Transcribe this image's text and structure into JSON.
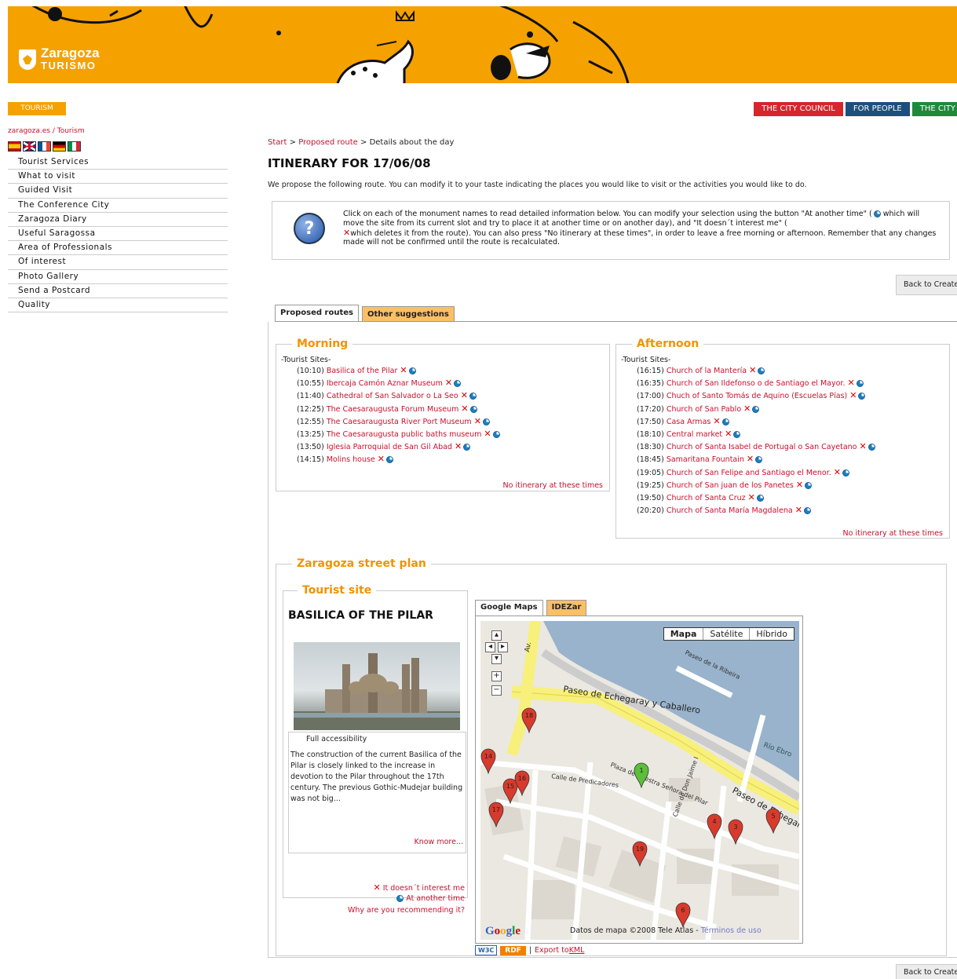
{
  "header": {
    "logo_line1": "Zaragoza",
    "logo_line2": "TURISMO",
    "tourism_tab": "TOURISM",
    "top_tabs": [
      {
        "label": "THE CITY COUNCIL",
        "color": "#d6252d"
      },
      {
        "label": "FOR PEOPLE",
        "color": "#1d4f7c"
      },
      {
        "label": "THE CITY",
        "color": "#1c8a3a"
      }
    ]
  },
  "sidebar": {
    "breadcrumb": "zaragoza.es / Tourism",
    "flags": [
      "spanish-flag-icon",
      "english-flag-icon",
      "french-flag-icon",
      "german-flag-icon",
      "italian-flag-icon"
    ],
    "items": [
      "Tourist Services",
      "What to visit",
      "Guided Visit",
      "The Conference City",
      "Zaragoza Diary",
      "Useful Saragossa",
      "Area of Professionals",
      "Of interest",
      "Photo Gallery",
      "Send a Postcard",
      "Quality"
    ]
  },
  "main": {
    "breadcrumb": {
      "start": "Start",
      "sep1": " > ",
      "route": "Proposed route",
      "sep2": " > ",
      "current": "Details about the day"
    },
    "title": "ITINERARY FOR 17/06/08",
    "intro": "We propose the following route. You can modify it to your taste indicating the places you would like to visit or the activities you would like to do.",
    "info": {
      "part1": "Click on each of the monument names to read detailed information below. You can modify your selection using the button \"At another time\" (",
      "part2": " which will move the site from its current slot and try to place it at another time or on another day), and \"It doesn´t interest me\" (",
      "part3": "which deletes it from the route). You can also press \"No itinerary at these times\", in order to leave a free morning or afternoon. Remember that any changes made will not be confirmed until the route is recalculated."
    },
    "back_button": "Back to Create",
    "tabs": {
      "proposed": "Proposed routes",
      "other": "Other suggestions"
    },
    "morning": {
      "title": "Morning",
      "label": "-Tourist Sites-",
      "items": [
        {
          "time": "(10:10)",
          "name": "Basilica of the Pilar"
        },
        {
          "time": "(10:55)",
          "name": "Ibercaja Camón Aznar Museum"
        },
        {
          "time": "(11:40)",
          "name": "Cathedral of San Salvador o La Seo"
        },
        {
          "time": "(12:25)",
          "name": "The Caesaraugusta Forum Museum"
        },
        {
          "time": "(12:55)",
          "name": "The Caesaraugusta River Port Museum"
        },
        {
          "time": "(13:25)",
          "name": "The Caesaraugusta public baths museum"
        },
        {
          "time": "(13:50)",
          "name": "Iglesia Parroquial de San Gil Abad"
        },
        {
          "time": "(14:15)",
          "name": "Molins house"
        }
      ],
      "no_itinerary": "No itinerary at these times"
    },
    "afternoon": {
      "title": "Afternoon",
      "label": "-Tourist Sites-",
      "items": [
        {
          "time": "(16:15)",
          "name": "Church of la Mantería"
        },
        {
          "time": "(16:35)",
          "name": "Church of San Ildefonso o de Santiago el Mayor."
        },
        {
          "time": "(17:00)",
          "name": "Chuch of Santo Tomás de Aquino (Escuelas Pías)"
        },
        {
          "time": "(17:20)",
          "name": "Church of San Pablo"
        },
        {
          "time": "(17:50)",
          "name": "Casa Armas"
        },
        {
          "time": "(18:10)",
          "name": "Central market"
        },
        {
          "time": "(18:30)",
          "name": "Church of Santa Isabel de Portugal o San Cayetano"
        },
        {
          "time": "(18:45)",
          "name": "Samaritana Fountain"
        },
        {
          "time": "(19:05)",
          "name": "Church of San Felipe and Santiago el Menor."
        },
        {
          "time": "(19:25)",
          "name": "Church of San juan de los Panetes"
        },
        {
          "time": "(19:50)",
          "name": "Church of Santa Cruz"
        },
        {
          "time": "(20:20)",
          "name": "Church of Santa María Magdalena"
        }
      ],
      "no_itinerary": "No itinerary at these times"
    },
    "plan": {
      "title": "Zaragoza street plan",
      "site": {
        "legend": "Tourist site",
        "name": "BASILICA OF THE PILAR",
        "accessibility": "Full accessibility",
        "description": "The construction of the current Basilica of the Pilar is closely linked to the increase in devotion to the Pilar throughout the 17th century. The previous Gothic-Mudejar building was not big...",
        "know_more": "Know more...",
        "not_interest": "It doesn´t interest me",
        "another_time": "At another time",
        "why": "Why are you recommending it?"
      },
      "map": {
        "tabs": [
          "Google Maps",
          "IDEZar"
        ],
        "types": [
          "Mapa",
          "Satélite",
          "Híbrido"
        ],
        "streets": [
          "Paseo de Echegaray y Caballero",
          "Paseo de Echegaray",
          "Calle de Predicadores",
          "Plaza de Nuestra Señora del Pilar",
          "Calle de Don Jaime I",
          "Paseo de la Ribeira",
          "Río Ebro",
          "Av."
        ],
        "markers": [
          "1",
          "3",
          "4",
          "5",
          "6",
          "14",
          "15",
          "16",
          "17",
          "18",
          "19"
        ],
        "logo": "Google",
        "attribution": "Datos de mapa ©2008 Tele Atlas - ",
        "terms": "Términos de uso",
        "w3c": "W3C",
        "rdf": "RDF",
        "sep": "|",
        "export_prefix": "Export to ",
        "export_link": "KML"
      }
    }
  }
}
